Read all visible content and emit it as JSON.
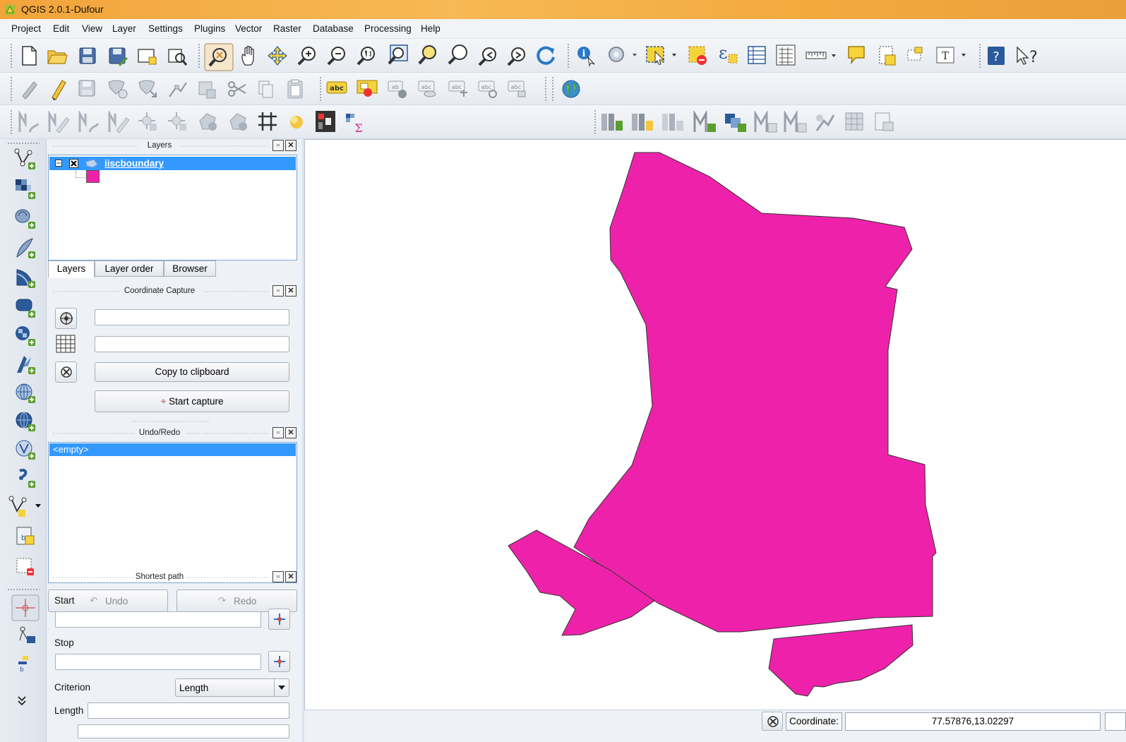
{
  "window": {
    "title": "QGIS 2.0.1-Dufour"
  },
  "menu": [
    "Project",
    "Edit",
    "View",
    "Layer",
    "Settings",
    "Plugins",
    "Vector",
    "Raster",
    "Database",
    "Processing",
    "Help"
  ],
  "layers_panel": {
    "title": "Layers",
    "layer_name": "iiscboundary",
    "fill_color": "#ee22aa",
    "tabs": [
      "Layers",
      "Layer order",
      "Browser"
    ]
  },
  "coordinate_capture": {
    "title": "Coordinate Capture",
    "field1_value": "",
    "field2_value": "",
    "copy_label": "Copy to clipboard",
    "start_label": "Start capture"
  },
  "undo_redo": {
    "title": "Undo/Redo",
    "entry": "<empty>",
    "undo_label": "Undo",
    "redo_label": "Redo"
  },
  "shortest_path": {
    "title": "Shortest path",
    "start_label": "Start",
    "stop_label": "Stop",
    "criterion_label": "Criterion",
    "criterion_value": "Length",
    "length_label": "Length"
  },
  "statusbar": {
    "coordinate_label": "Coordinate:",
    "coordinate_value": "77.57876,13.02297"
  },
  "colors": {
    "selection": "#3399ff",
    "polygon_fill": "#ee22aa",
    "titlebar": "#f2a43a"
  }
}
